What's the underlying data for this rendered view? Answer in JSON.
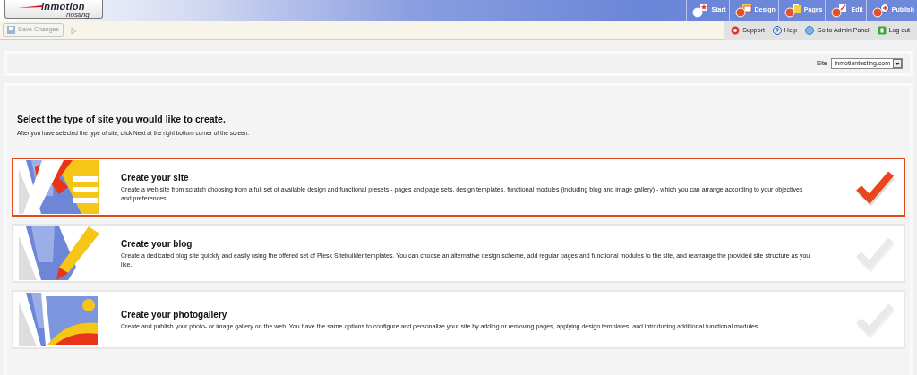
{
  "logo": {
    "name": "inmotion",
    "tagline": "hosting"
  },
  "wizard_steps": [
    {
      "label": "Start",
      "kind": "start"
    },
    {
      "label": "Design",
      "kind": "design"
    },
    {
      "label": "Pages",
      "kind": "pages"
    },
    {
      "label": "Edit",
      "kind": "edit"
    },
    {
      "label": "Publish",
      "kind": "publish"
    }
  ],
  "toolbar": {
    "save_button": {
      "label": "Save Changes",
      "disabled": true
    },
    "links": [
      {
        "label": "Support",
        "kind": "support"
      },
      {
        "label": "Help",
        "kind": "help"
      },
      {
        "label": "Go to Admin Panel",
        "kind": "admin"
      },
      {
        "label": "Log out",
        "kind": "logout"
      }
    ]
  },
  "site_selector": {
    "label": "Site",
    "value": "inmotiontesting.com"
  },
  "heading": "Select the type of site you would like to create.",
  "subheading": "After you have selected the type of site, click Next at the right bottom corner of the screen.",
  "site_types": [
    {
      "kind": "site",
      "title": "Create your site",
      "description": "Create a web site from scratch choosing from a full set of available design and functional presets - pages and page sets, design templates, functional modules (including blog and image gallery) - which you can arrange according to your objectives and preferences.",
      "selected": true
    },
    {
      "kind": "blog",
      "title": "Create your blog",
      "description": "Create a dedicated blog site quickly and easily using the offered set of Plesk Sitebuilder templates. You can choose an alternative design scheme, add regular pages and functional modules to the site, and rearrange the provided site structure as you like.",
      "selected": false
    },
    {
      "kind": "photogallery",
      "title": "Create your photogallery",
      "description": "Create and publish your photo- or image gallery on the web. You have the same options to configure and personalize your site by adding or removing pages, applying design templates, and introducing additional functional modules.",
      "selected": false
    }
  ]
}
